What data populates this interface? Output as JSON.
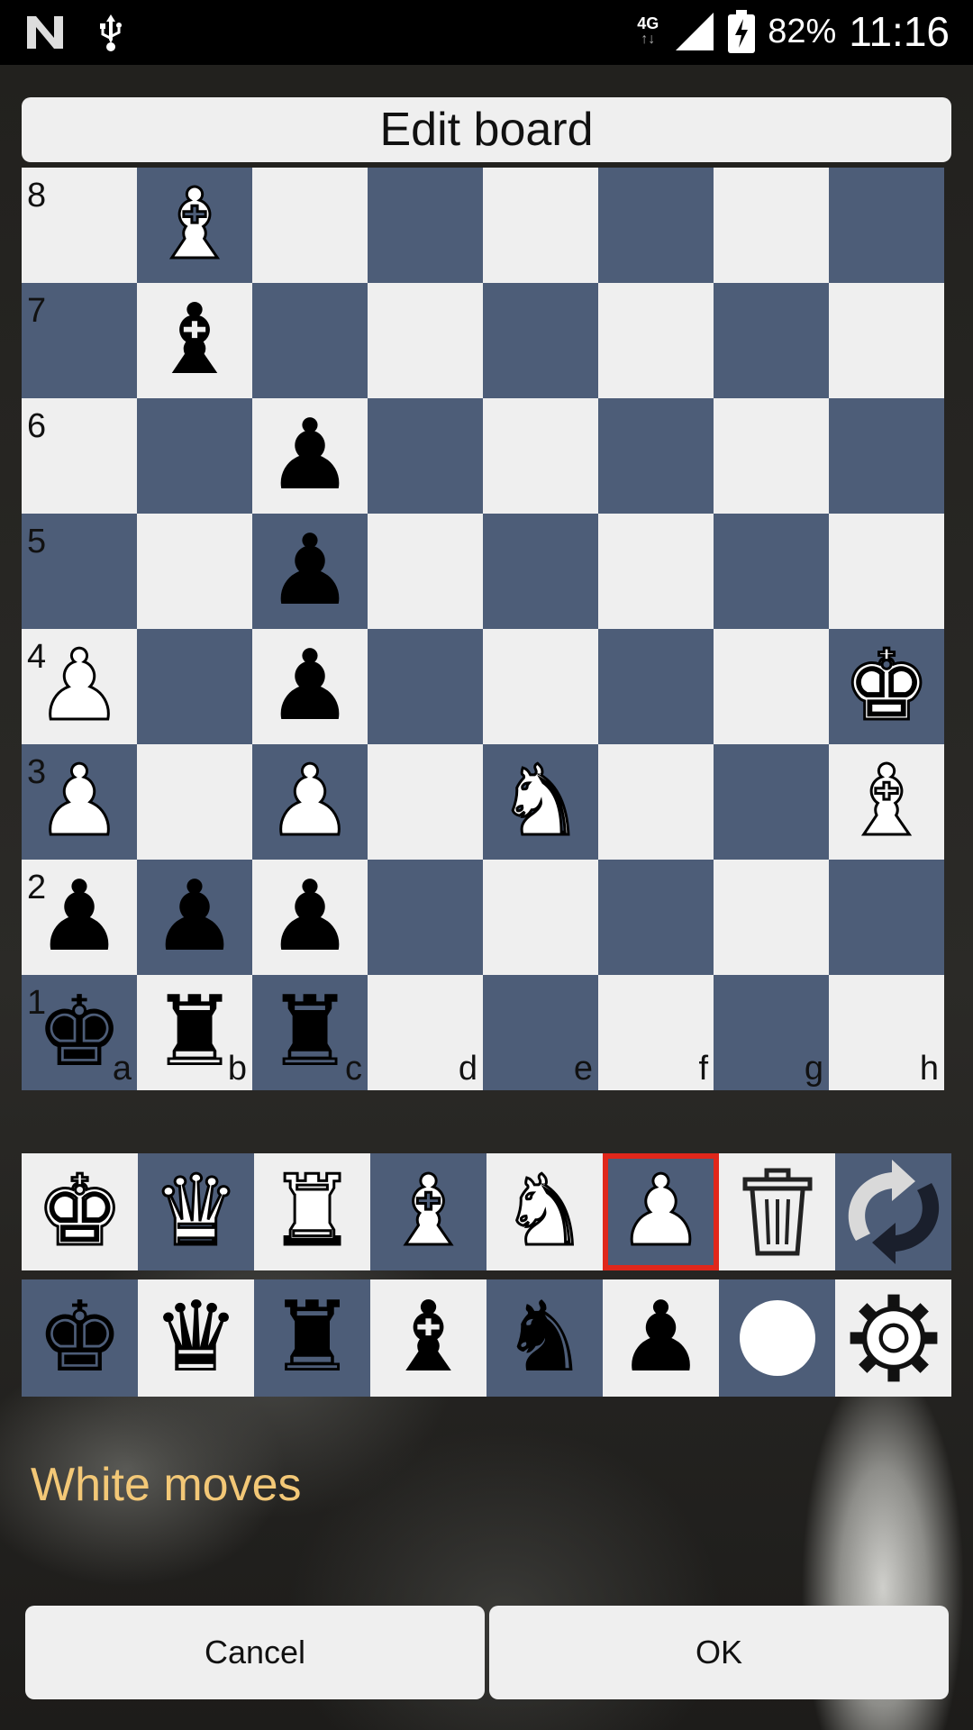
{
  "status_bar": {
    "network": "4G",
    "battery": "82%",
    "time": "11:16"
  },
  "dialog": {
    "title": "Edit board",
    "status": "White moves",
    "cancel_label": "Cancel",
    "ok_label": "OK"
  },
  "board": {
    "files": [
      "a",
      "b",
      "c",
      "d",
      "e",
      "f",
      "g",
      "h"
    ],
    "ranks": [
      "8",
      "7",
      "6",
      "5",
      "4",
      "3",
      "2",
      "1"
    ],
    "pieces": [
      {
        "square": "b8",
        "piece": "white-bishop",
        "glyph": "♝",
        "color": "white"
      },
      {
        "square": "b7",
        "piece": "black-bishop",
        "glyph": "♝",
        "color": "black"
      },
      {
        "square": "c6",
        "piece": "black-pawn",
        "glyph": "♟",
        "color": "black"
      },
      {
        "square": "c5",
        "piece": "black-pawn",
        "glyph": "♟",
        "color": "black"
      },
      {
        "square": "a4",
        "piece": "white-pawn",
        "glyph": "♟",
        "color": "white"
      },
      {
        "square": "c4",
        "piece": "black-pawn",
        "glyph": "♟",
        "color": "black"
      },
      {
        "square": "h4",
        "piece": "white-king",
        "glyph": "♚",
        "color": "white"
      },
      {
        "square": "a3",
        "piece": "white-pawn",
        "glyph": "♟",
        "color": "white"
      },
      {
        "square": "c3",
        "piece": "white-pawn",
        "glyph": "♟",
        "color": "white"
      },
      {
        "square": "e3",
        "piece": "white-knight",
        "glyph": "♞",
        "color": "white"
      },
      {
        "square": "h3",
        "piece": "white-bishop",
        "glyph": "♝",
        "color": "white"
      },
      {
        "square": "a2",
        "piece": "black-pawn",
        "glyph": "♟",
        "color": "black"
      },
      {
        "square": "b2",
        "piece": "black-pawn",
        "glyph": "♟",
        "color": "black"
      },
      {
        "square": "c2",
        "piece": "black-pawn",
        "glyph": "♟",
        "color": "black"
      },
      {
        "square": "a1",
        "piece": "black-king",
        "glyph": "♚",
        "color": "black"
      },
      {
        "square": "b1",
        "piece": "black-rook",
        "glyph": "♜",
        "color": "black"
      },
      {
        "square": "c1",
        "piece": "black-rook",
        "glyph": "♜",
        "color": "black"
      }
    ]
  },
  "palette": {
    "white_row": [
      {
        "name": "white-king",
        "glyph": "♚",
        "color": "white",
        "bg": "light"
      },
      {
        "name": "white-queen",
        "glyph": "♛",
        "color": "white",
        "bg": "dark"
      },
      {
        "name": "white-rook",
        "glyph": "♜",
        "color": "white",
        "bg": "light"
      },
      {
        "name": "white-bishop",
        "glyph": "♝",
        "color": "white",
        "bg": "dark"
      },
      {
        "name": "white-knight",
        "glyph": "♞",
        "color": "white",
        "bg": "light"
      },
      {
        "name": "white-pawn",
        "glyph": "♟",
        "color": "white",
        "bg": "dark",
        "selected": true
      },
      {
        "name": "trash",
        "glyph": "",
        "color": "none",
        "bg": "light"
      },
      {
        "name": "flip-board",
        "glyph": "",
        "color": "none",
        "bg": "dark"
      }
    ],
    "black_row": [
      {
        "name": "black-king",
        "glyph": "♚",
        "color": "black",
        "bg": "dark"
      },
      {
        "name": "black-queen",
        "glyph": "♛",
        "color": "black",
        "bg": "light"
      },
      {
        "name": "black-rook",
        "glyph": "♜",
        "color": "black",
        "bg": "dark"
      },
      {
        "name": "black-bishop",
        "glyph": "♝",
        "color": "black",
        "bg": "light"
      },
      {
        "name": "black-knight",
        "glyph": "♞",
        "color": "black",
        "bg": "dark"
      },
      {
        "name": "black-pawn",
        "glyph": "♟",
        "color": "black",
        "bg": "light"
      },
      {
        "name": "side-to-move",
        "glyph": "",
        "color": "none",
        "bg": "dark"
      },
      {
        "name": "settings",
        "glyph": "",
        "color": "none",
        "bg": "light"
      }
    ]
  },
  "colors": {
    "light_square": "#efefef",
    "dark_square": "#4d5d78",
    "selection": "#e0271b",
    "status_text": "#f3c877"
  }
}
